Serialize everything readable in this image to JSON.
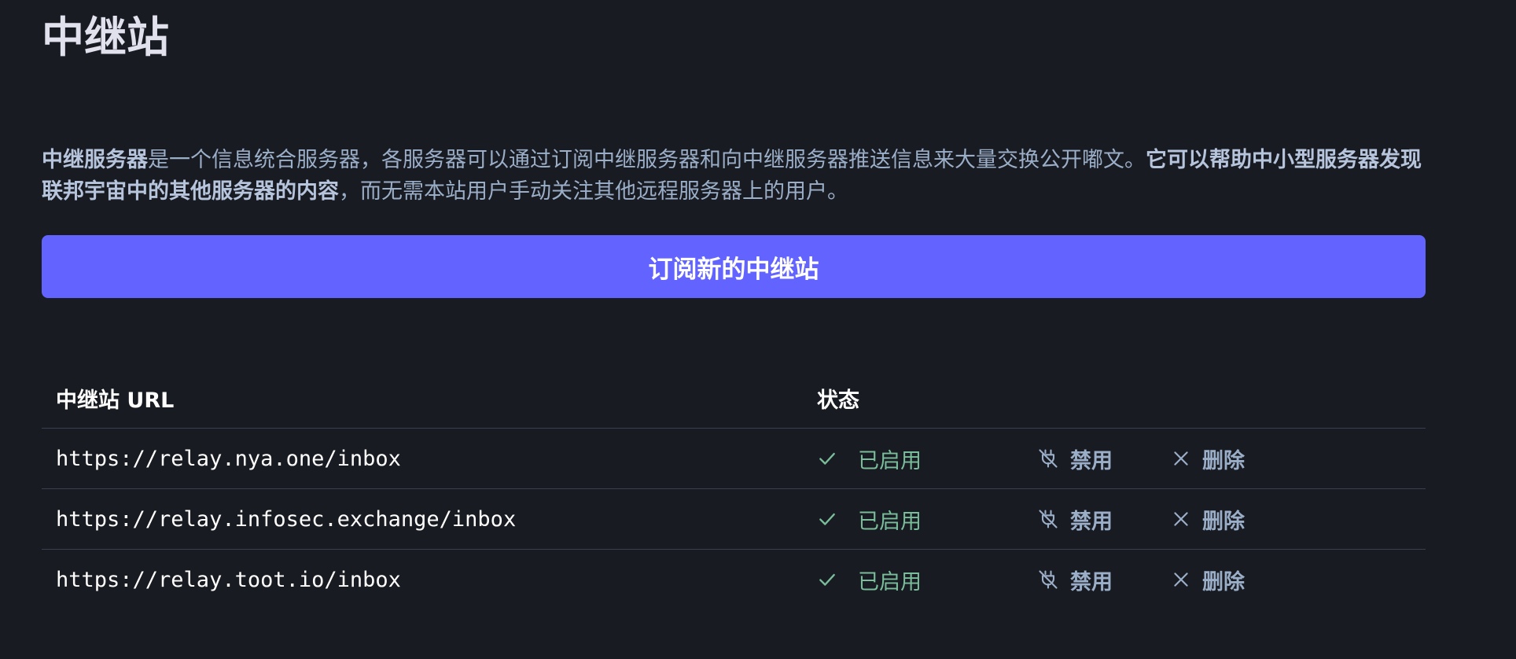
{
  "page": {
    "title": "中继站",
    "description": {
      "part1_bold": "中继服务器",
      "part2": "是一个信息统合服务器，各服务器可以通过订阅中继服务器和向中继服务器推送信息来大量交换公开嘟文。",
      "part3_bold": "它可以帮助中小型服务器发现联邦宇宙中的其他服务器的内容",
      "part4": "，而无需本站用户手动关注其他远程服务器上的用户。"
    },
    "subscribe_button_label": "订阅新的中继站"
  },
  "table": {
    "headers": {
      "url": "中继站 URL",
      "status": "状态"
    },
    "rows": [
      {
        "url": "https://relay.nya.one/inbox",
        "status": "已启用",
        "disable_label": "禁用",
        "delete_label": "删除"
      },
      {
        "url": "https://relay.infosec.exchange/inbox",
        "status": "已启用",
        "disable_label": "禁用",
        "delete_label": "删除"
      },
      {
        "url": "https://relay.toot.io/inbox",
        "status": "已启用",
        "disable_label": "禁用",
        "delete_label": "删除"
      }
    ]
  },
  "icons": {
    "status": "check-icon",
    "disable": "plug-off-icon",
    "delete": "close-icon"
  },
  "colors": {
    "background": "#191b22",
    "accent": "#6364ff",
    "enabled": "#79bd9a",
    "secondary_text": "#9baec8"
  }
}
